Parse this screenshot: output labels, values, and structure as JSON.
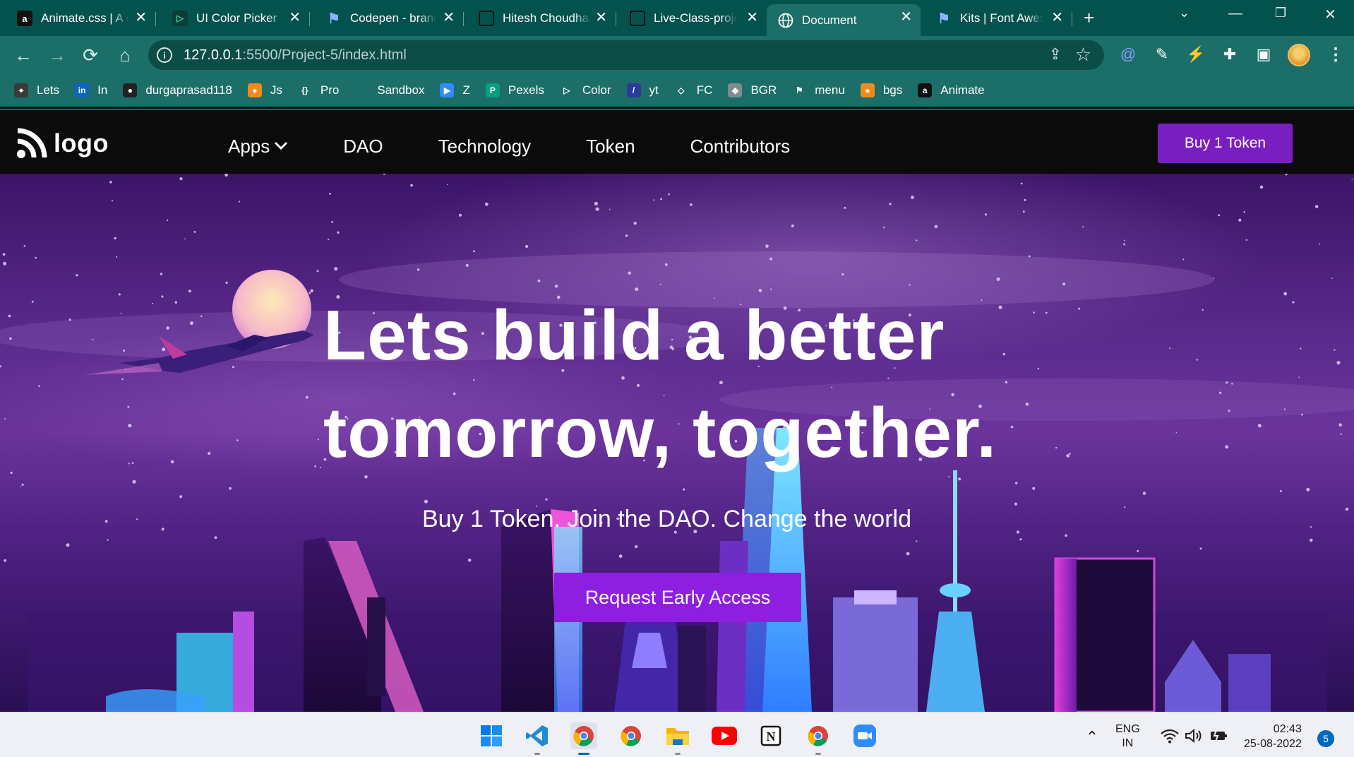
{
  "browser": {
    "tabs": [
      {
        "title": "Animate.css | A cross-browser library",
        "favicon": "a"
      },
      {
        "title": "UI Color Picker",
        "favicon": "▷"
      },
      {
        "title": "Codepen - brand",
        "favicon": "⚑"
      },
      {
        "title": "Hitesh Choudhary",
        "favicon": ""
      },
      {
        "title": "Live-Class-project",
        "favicon": ""
      },
      {
        "title": "Document",
        "favicon": "globe"
      },
      {
        "title": "Kits | Font Awesome",
        "favicon": "⚑"
      }
    ],
    "url_host": "127.0.0.1",
    "url_path": ":5500/Project-5/index.html",
    "bookmarks": [
      {
        "label": "Lets",
        "icon": "⌖",
        "color": "#3a3a3a"
      },
      {
        "label": "In",
        "icon": "in",
        "color": "#0a66c2"
      },
      {
        "label": "durgaprasad118",
        "icon": "●",
        "color": "#222222"
      },
      {
        "label": "Js",
        "icon": "●",
        "color": "#f18a1c"
      },
      {
        "label": "Pro",
        "icon": "{}",
        "color": "#1b6f68"
      },
      {
        "label": "Sandbox",
        "icon": "",
        "color": "#1b6f68"
      },
      {
        "label": "Z",
        "icon": "▶",
        "color": "#2d8cff"
      },
      {
        "label": "Pexels",
        "icon": "P",
        "color": "#05a081"
      },
      {
        "label": "Color",
        "icon": "▷",
        "color": "#1b6f68"
      },
      {
        "label": "yt",
        "icon": "/",
        "color": "#2b3a9c"
      },
      {
        "label": "FC",
        "icon": "◇",
        "color": "#1b6f68"
      },
      {
        "label": "BGR",
        "icon": "◆",
        "color": "#7f8c8d"
      },
      {
        "label": "menu",
        "icon": "⚑",
        "color": "#1b6f68"
      },
      {
        "label": "bgs",
        "icon": "●",
        "color": "#f18a1c"
      },
      {
        "label": "Animate",
        "icon": "a",
        "color": "#111111"
      }
    ]
  },
  "site": {
    "logo_text": "logo",
    "nav": [
      "Apps",
      "DAO",
      "Technology",
      "Token",
      "Contributors"
    ],
    "buy_button": "Buy 1 Token",
    "hero_line1": "Lets build a better",
    "hero_line2": "tomorrow, together.",
    "hero_sub": "Buy 1 Token. Join the DAO. Change the world",
    "cta": "Request Early Access"
  },
  "taskbar": {
    "lang_top": "ENG",
    "lang_bottom": "IN",
    "time": "02:43",
    "date": "25-08-2022",
    "notifications": "5"
  },
  "colors": {
    "browser_frame": "#04524d",
    "toolbar": "#1b6f68",
    "site_nav_bg": "#0b0b0b",
    "buy_button": "#7a1fbf",
    "cta": "#8e1ee0"
  }
}
